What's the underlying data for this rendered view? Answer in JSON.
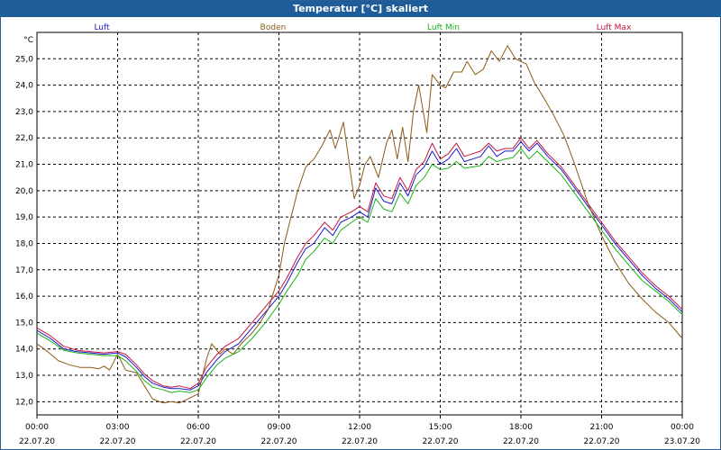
{
  "window": {
    "title": "Temperatur [°C] skaliert"
  },
  "chart_data": {
    "type": "line",
    "title": "Temperatur [°C] skaliert",
    "ylabel": "°C",
    "ylim": [
      11.5,
      26.0
    ],
    "yticks": [
      12.0,
      13.0,
      14.0,
      15.0,
      16.0,
      17.0,
      18.0,
      19.0,
      20.0,
      21.0,
      22.0,
      23.0,
      24.0,
      25.0
    ],
    "ytick_labels": [
      "12,0",
      "13,0",
      "14,0",
      "15,0",
      "16,0",
      "17,0",
      "18,0",
      "19,0",
      "20,0",
      "21,0",
      "22,0",
      "23,0",
      "24,0",
      "25,0"
    ],
    "xlim": [
      0,
      24
    ],
    "xticks": [
      {
        "hour": 0,
        "time": "00:00",
        "date": "22.07.20"
      },
      {
        "hour": 3,
        "time": "03:00",
        "date": "22.07.20"
      },
      {
        "hour": 6,
        "time": "06:00",
        "date": "22.07.20"
      },
      {
        "hour": 9,
        "time": "09:00",
        "date": "22.07.20"
      },
      {
        "hour": 12,
        "time": "12:00",
        "date": "22.07.20"
      },
      {
        "hour": 15,
        "time": "15:00",
        "date": "22.07.20"
      },
      {
        "hour": 18,
        "time": "18:00",
        "date": "22.07.20"
      },
      {
        "hour": 21,
        "time": "21:00",
        "date": "22.07.20"
      },
      {
        "hour": 24,
        "time": "00:00",
        "date": "23.07.20"
      }
    ],
    "grid": true,
    "legend_position": "top",
    "series": [
      {
        "name": "Luft",
        "color": "#1a1acc",
        "points": [
          [
            0,
            14.7
          ],
          [
            0.5,
            14.4
          ],
          [
            1,
            14.0
          ],
          [
            1.5,
            13.9
          ],
          [
            2,
            13.85
          ],
          [
            2.5,
            13.8
          ],
          [
            3,
            13.85
          ],
          [
            3.3,
            13.7
          ],
          [
            3.7,
            13.3
          ],
          [
            4,
            12.95
          ],
          [
            4.3,
            12.7
          ],
          [
            4.7,
            12.55
          ],
          [
            5,
            12.5
          ],
          [
            5.3,
            12.5
          ],
          [
            5.7,
            12.45
          ],
          [
            6,
            12.6
          ],
          [
            6.3,
            13.1
          ],
          [
            6.7,
            13.6
          ],
          [
            7,
            13.9
          ],
          [
            7.5,
            14.2
          ],
          [
            8,
            14.8
          ],
          [
            8.5,
            15.4
          ],
          [
            9,
            16.0
          ],
          [
            9.3,
            16.5
          ],
          [
            9.7,
            17.3
          ],
          [
            10,
            17.8
          ],
          [
            10.3,
            18.0
          ],
          [
            10.7,
            18.6
          ],
          [
            11,
            18.3
          ],
          [
            11.3,
            18.8
          ],
          [
            11.7,
            19.0
          ],
          [
            12,
            19.2
          ],
          [
            12.3,
            19.0
          ],
          [
            12.6,
            20.1
          ],
          [
            12.9,
            19.6
          ],
          [
            13.2,
            19.5
          ],
          [
            13.5,
            20.3
          ],
          [
            13.8,
            19.8
          ],
          [
            14.1,
            20.6
          ],
          [
            14.4,
            20.9
          ],
          [
            14.7,
            21.5
          ],
          [
            15,
            21.0
          ],
          [
            15.3,
            21.2
          ],
          [
            15.6,
            21.6
          ],
          [
            15.9,
            21.1
          ],
          [
            16.2,
            21.2
          ],
          [
            16.5,
            21.3
          ],
          [
            16.8,
            21.7
          ],
          [
            17.1,
            21.3
          ],
          [
            17.4,
            21.5
          ],
          [
            17.7,
            21.5
          ],
          [
            18,
            21.85
          ],
          [
            18.3,
            21.5
          ],
          [
            18.6,
            21.8
          ],
          [
            19,
            21.3
          ],
          [
            19.5,
            20.8
          ],
          [
            20,
            20.1
          ],
          [
            20.5,
            19.4
          ],
          [
            21,
            18.7
          ],
          [
            21.5,
            18.0
          ],
          [
            22,
            17.4
          ],
          [
            22.5,
            16.8
          ],
          [
            23,
            16.3
          ],
          [
            23.5,
            15.9
          ],
          [
            24,
            15.4
          ]
        ]
      },
      {
        "name": "Boden",
        "color": "#8b5a14",
        "points": [
          [
            0,
            14.2
          ],
          [
            0.4,
            13.9
          ],
          [
            0.8,
            13.55
          ],
          [
            1.2,
            13.4
          ],
          [
            1.6,
            13.3
          ],
          [
            2,
            13.3
          ],
          [
            2.3,
            13.25
          ],
          [
            2.5,
            13.35
          ],
          [
            2.7,
            13.2
          ],
          [
            3,
            13.8
          ],
          [
            3.3,
            13.2
          ],
          [
            3.7,
            13.1
          ],
          [
            4,
            12.6
          ],
          [
            4.3,
            12.1
          ],
          [
            4.7,
            11.95
          ],
          [
            5,
            12.0
          ],
          [
            5.3,
            11.95
          ],
          [
            5.6,
            12.1
          ],
          [
            6,
            12.3
          ],
          [
            6.3,
            13.6
          ],
          [
            6.5,
            14.2
          ],
          [
            6.8,
            13.8
          ],
          [
            7,
            14.0
          ],
          [
            7.3,
            13.8
          ],
          [
            7.6,
            14.2
          ],
          [
            8,
            14.6
          ],
          [
            8.3,
            15.0
          ],
          [
            8.6,
            15.5
          ],
          [
            9,
            16.8
          ],
          [
            9.2,
            18.0
          ],
          [
            9.4,
            18.8
          ],
          [
            9.7,
            20.0
          ],
          [
            10,
            20.9
          ],
          [
            10.3,
            21.2
          ],
          [
            10.6,
            21.7
          ],
          [
            10.9,
            22.3
          ],
          [
            11.1,
            21.6
          ],
          [
            11.4,
            22.6
          ],
          [
            11.8,
            19.7
          ],
          [
            12,
            20.2
          ],
          [
            12.2,
            21.0
          ],
          [
            12.4,
            21.3
          ],
          [
            12.7,
            20.5
          ],
          [
            13,
            21.8
          ],
          [
            13.2,
            22.3
          ],
          [
            13.4,
            21.2
          ],
          [
            13.6,
            22.4
          ],
          [
            13.8,
            21.1
          ],
          [
            14,
            23.0
          ],
          [
            14.2,
            24.0
          ],
          [
            14.5,
            22.2
          ],
          [
            14.7,
            24.4
          ],
          [
            15,
            24.0
          ],
          [
            15.2,
            23.9
          ],
          [
            15.5,
            24.5
          ],
          [
            15.8,
            24.5
          ],
          [
            16,
            24.9
          ],
          [
            16.3,
            24.4
          ],
          [
            16.6,
            24.6
          ],
          [
            16.9,
            25.3
          ],
          [
            17.2,
            24.9
          ],
          [
            17.5,
            25.5
          ],
          [
            17.8,
            25.0
          ],
          [
            18.2,
            24.8
          ],
          [
            18.5,
            24.1
          ],
          [
            18.8,
            23.6
          ],
          [
            19.2,
            22.9
          ],
          [
            19.6,
            22.1
          ],
          [
            20,
            21.0
          ],
          [
            20.5,
            19.5
          ],
          [
            21,
            18.3
          ],
          [
            21.5,
            17.3
          ],
          [
            22,
            16.5
          ],
          [
            22.5,
            15.9
          ],
          [
            23,
            15.4
          ],
          [
            23.5,
            15.0
          ],
          [
            24,
            14.4
          ]
        ]
      },
      {
        "name": "Luft Min",
        "color": "#19b419",
        "points": [
          [
            0,
            14.6
          ],
          [
            0.5,
            14.3
          ],
          [
            1,
            13.95
          ],
          [
            1.5,
            13.85
          ],
          [
            2,
            13.8
          ],
          [
            2.5,
            13.75
          ],
          [
            3,
            13.75
          ],
          [
            3.3,
            13.55
          ],
          [
            3.7,
            13.15
          ],
          [
            4,
            12.8
          ],
          [
            4.3,
            12.55
          ],
          [
            4.7,
            12.45
          ],
          [
            5,
            12.35
          ],
          [
            5.3,
            12.4
          ],
          [
            5.7,
            12.35
          ],
          [
            6,
            12.45
          ],
          [
            6.3,
            12.9
          ],
          [
            6.7,
            13.4
          ],
          [
            7,
            13.65
          ],
          [
            7.5,
            13.9
          ],
          [
            8,
            14.4
          ],
          [
            8.5,
            15.0
          ],
          [
            9,
            15.7
          ],
          [
            9.3,
            16.2
          ],
          [
            9.7,
            16.8
          ],
          [
            10,
            17.4
          ],
          [
            10.3,
            17.7
          ],
          [
            10.7,
            18.2
          ],
          [
            11,
            18.0
          ],
          [
            11.3,
            18.5
          ],
          [
            11.7,
            18.8
          ],
          [
            12,
            19.0
          ],
          [
            12.3,
            18.8
          ],
          [
            12.6,
            19.7
          ],
          [
            12.9,
            19.3
          ],
          [
            13.2,
            19.2
          ],
          [
            13.5,
            19.9
          ],
          [
            13.8,
            19.5
          ],
          [
            14.1,
            20.2
          ],
          [
            14.4,
            20.5
          ],
          [
            14.7,
            21.0
          ],
          [
            15,
            20.8
          ],
          [
            15.3,
            20.85
          ],
          [
            15.6,
            21.1
          ],
          [
            15.9,
            20.85
          ],
          [
            16.2,
            20.9
          ],
          [
            16.5,
            20.95
          ],
          [
            16.8,
            21.3
          ],
          [
            17.1,
            21.1
          ],
          [
            17.4,
            21.2
          ],
          [
            17.7,
            21.25
          ],
          [
            18,
            21.6
          ],
          [
            18.3,
            21.2
          ],
          [
            18.6,
            21.5
          ],
          [
            19,
            21.1
          ],
          [
            19.5,
            20.6
          ],
          [
            20,
            19.9
          ],
          [
            20.5,
            19.2
          ],
          [
            21,
            18.5
          ],
          [
            21.5,
            17.8
          ],
          [
            22,
            17.2
          ],
          [
            22.5,
            16.6
          ],
          [
            23,
            16.2
          ],
          [
            23.5,
            15.8
          ],
          [
            24,
            15.3
          ]
        ]
      },
      {
        "name": "Luft Max",
        "color": "#c8143c",
        "points": [
          [
            0,
            14.8
          ],
          [
            0.5,
            14.5
          ],
          [
            1,
            14.1
          ],
          [
            1.5,
            13.95
          ],
          [
            2,
            13.9
          ],
          [
            2.5,
            13.85
          ],
          [
            3,
            13.9
          ],
          [
            3.3,
            13.8
          ],
          [
            3.7,
            13.4
          ],
          [
            4,
            13.05
          ],
          [
            4.3,
            12.8
          ],
          [
            4.7,
            12.6
          ],
          [
            5,
            12.55
          ],
          [
            5.3,
            12.6
          ],
          [
            5.7,
            12.5
          ],
          [
            6,
            12.7
          ],
          [
            6.3,
            13.3
          ],
          [
            6.7,
            13.8
          ],
          [
            7,
            14.1
          ],
          [
            7.5,
            14.4
          ],
          [
            8,
            15.0
          ],
          [
            8.5,
            15.6
          ],
          [
            9,
            16.2
          ],
          [
            9.3,
            16.7
          ],
          [
            9.7,
            17.5
          ],
          [
            10,
            18.0
          ],
          [
            10.3,
            18.3
          ],
          [
            10.7,
            18.8
          ],
          [
            11,
            18.5
          ],
          [
            11.3,
            19.0
          ],
          [
            11.7,
            19.2
          ],
          [
            12,
            19.4
          ],
          [
            12.3,
            19.2
          ],
          [
            12.6,
            20.3
          ],
          [
            12.9,
            19.8
          ],
          [
            13.2,
            19.7
          ],
          [
            13.5,
            20.5
          ],
          [
            13.8,
            20.0
          ],
          [
            14.1,
            20.8
          ],
          [
            14.4,
            21.1
          ],
          [
            14.7,
            21.8
          ],
          [
            15,
            21.2
          ],
          [
            15.3,
            21.4
          ],
          [
            15.6,
            21.8
          ],
          [
            15.9,
            21.3
          ],
          [
            16.2,
            21.4
          ],
          [
            16.5,
            21.5
          ],
          [
            16.8,
            21.8
          ],
          [
            17.1,
            21.5
          ],
          [
            17.4,
            21.6
          ],
          [
            17.7,
            21.6
          ],
          [
            18,
            22.0
          ],
          [
            18.3,
            21.6
          ],
          [
            18.6,
            21.9
          ],
          [
            19,
            21.4
          ],
          [
            19.5,
            20.9
          ],
          [
            20,
            20.2
          ],
          [
            20.5,
            19.5
          ],
          [
            21,
            18.8
          ],
          [
            21.5,
            18.1
          ],
          [
            22,
            17.5
          ],
          [
            22.5,
            16.9
          ],
          [
            23,
            16.4
          ],
          [
            23.5,
            16.0
          ],
          [
            24,
            15.5
          ]
        ]
      }
    ]
  }
}
